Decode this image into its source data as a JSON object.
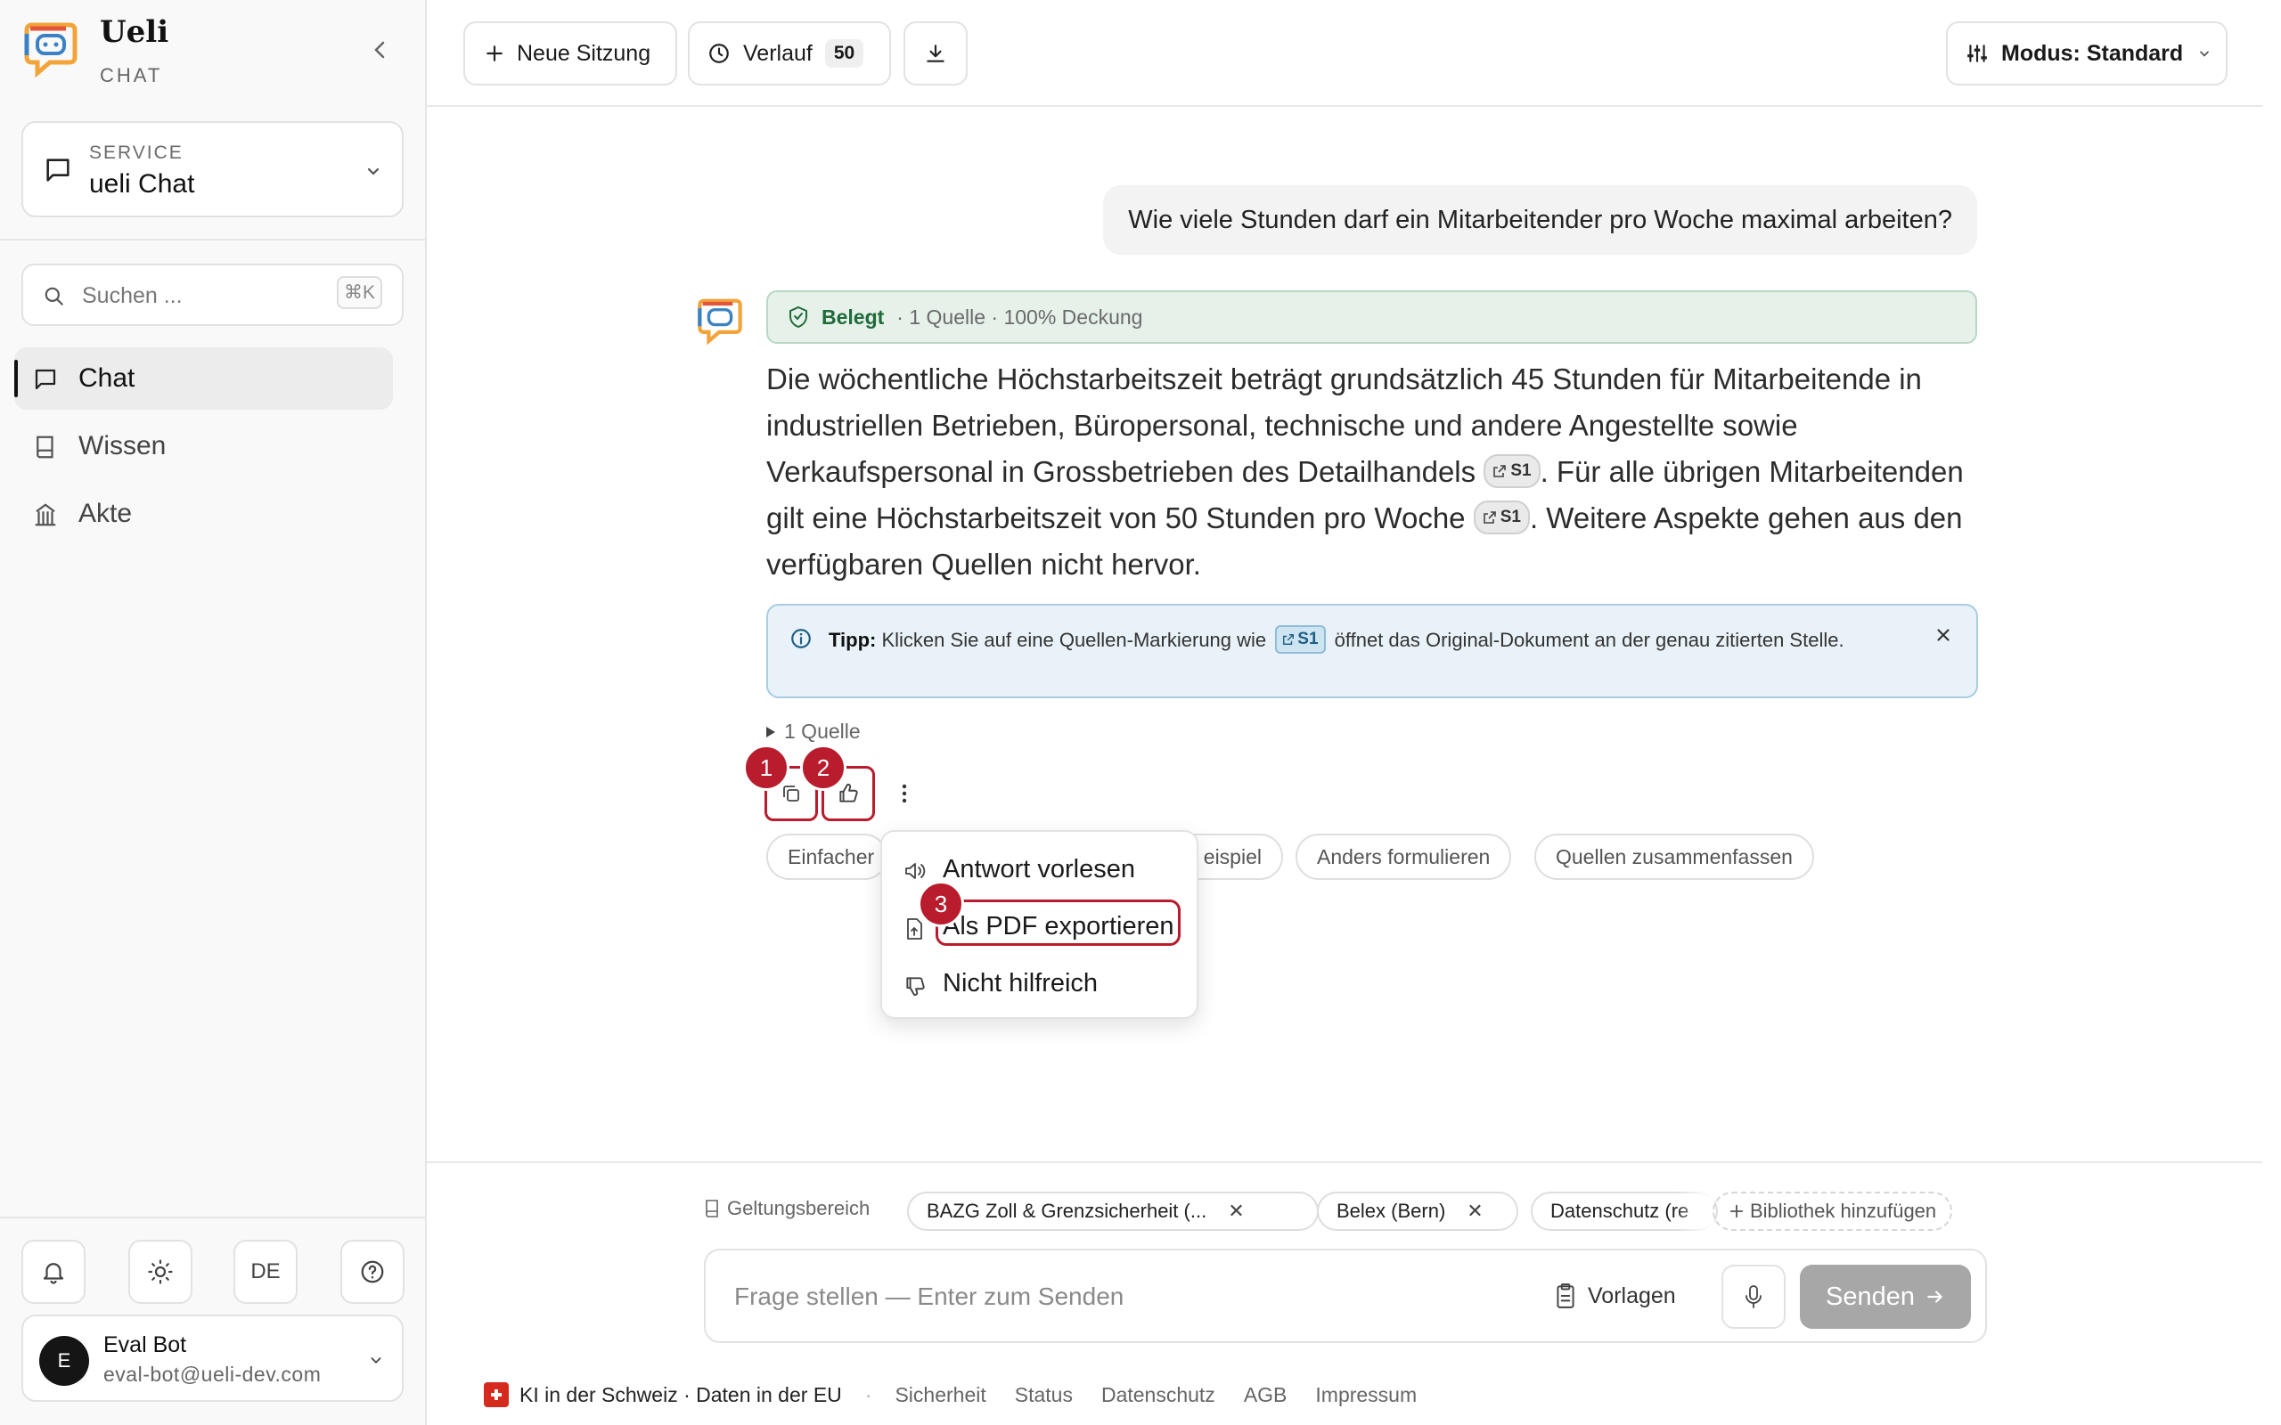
{
  "brand": {
    "name": "Ueli",
    "sub": "CHAT"
  },
  "service": {
    "label": "SERVICE",
    "value": "ueli Chat"
  },
  "search": {
    "placeholder": "Suchen ...",
    "shortcut": "⌘K"
  },
  "nav": [
    {
      "label": "Chat",
      "icon": "chat-bubble-icon",
      "active": true
    },
    {
      "label": "Wissen",
      "icon": "book-icon"
    },
    {
      "label": "Akte",
      "icon": "building-icon"
    }
  ],
  "sidebar_bottom": {
    "language": "DE"
  },
  "user": {
    "initial": "E",
    "name": "Eval Bot",
    "email": "eval-bot@ueli-dev.com"
  },
  "topbar": {
    "new_session": "Neue Sitzung",
    "history": "Verlauf",
    "history_count": "50",
    "mode": "Modus: Standard"
  },
  "conversation": {
    "user_message": "Wie viele Stunden darf ein Mitarbeitender pro Woche maximal arbeiten?",
    "status": {
      "label": "Belegt",
      "meta": "· 1 Quelle · 100% Deckung"
    },
    "answer": {
      "p1": "Die wöchentliche Höchstarbeitszeit beträgt grundsätzlich 45 Stunden für Mitarbeitende in industriellen Betrieben, Büropersonal, technische und andere Angestellte sowie Verkaufspersonal in Grossbetrieben des Detailhandels",
      "cite1": "S1",
      "p2": ". Für alle übrigen Mitarbeitenden gilt eine Höchstarbeitszeit von 50 Stunden pro Woche",
      "cite2": "S1",
      "p3": ". Weitere Aspekte gehen aus den verfügbaren Quellen nicht hervor."
    },
    "tip": {
      "bold": "Tipp:",
      "pre": "Klicken Sie auf eine Quellen-Markierung wie",
      "cite": "S1",
      "post": "öffnet das Original-Dokument an der genau zitierten Stelle."
    },
    "sources_toggle": "1 Quelle",
    "markers": [
      "1",
      "2",
      "3"
    ],
    "suggestions": [
      "Einfacher",
      "eispiel",
      "Anders formulieren",
      "Quellen zusammenfassen"
    ],
    "menu": [
      "Antwort vorlesen",
      "Als PDF exportieren",
      "Nicht hilfreich"
    ]
  },
  "composer": {
    "scope_label": "Geltungsbereich",
    "scopes": [
      "BAZG Zoll & Grenzsicherheit (...",
      "Belex (Bern)",
      "Datenschutz (re"
    ],
    "add_library": "Bibliothek hinzufügen",
    "placeholder": "Frage stellen — Enter zum Senden",
    "templates": "Vorlagen",
    "send": "Senden"
  },
  "footer": {
    "main": "KI in der Schweiz · Daten in der EU",
    "sep": "·",
    "links": [
      "Sicherheit",
      "Status",
      "Datenschutz",
      "AGB",
      "Impressum"
    ]
  },
  "colors": {
    "accent_red": "#b91c2c",
    "success_green": "#1f6b3a",
    "info_blue": "#1d5f86",
    "send_disabled": "#a7a7a7",
    "swiss_red": "#d52b1e"
  }
}
